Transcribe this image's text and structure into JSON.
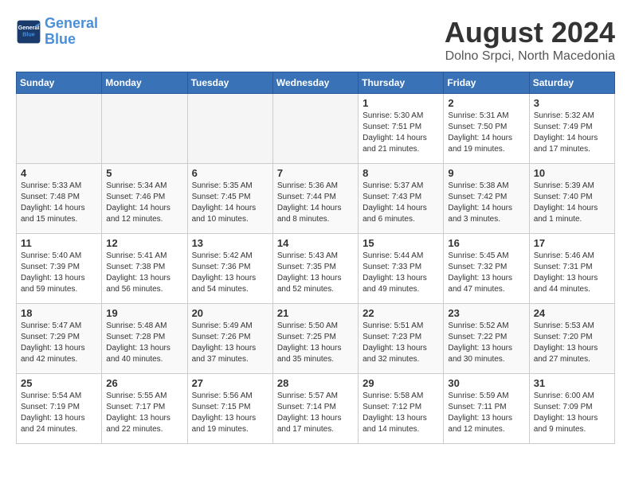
{
  "header": {
    "logo_line1": "General",
    "logo_line2": "Blue",
    "month": "August 2024",
    "location": "Dolno Srpci, North Macedonia"
  },
  "weekdays": [
    "Sunday",
    "Monday",
    "Tuesday",
    "Wednesday",
    "Thursday",
    "Friday",
    "Saturday"
  ],
  "weeks": [
    [
      {
        "day": "",
        "info": ""
      },
      {
        "day": "",
        "info": ""
      },
      {
        "day": "",
        "info": ""
      },
      {
        "day": "",
        "info": ""
      },
      {
        "day": "1",
        "info": "Sunrise: 5:30 AM\nSunset: 7:51 PM\nDaylight: 14 hours\nand 21 minutes."
      },
      {
        "day": "2",
        "info": "Sunrise: 5:31 AM\nSunset: 7:50 PM\nDaylight: 14 hours\nand 19 minutes."
      },
      {
        "day": "3",
        "info": "Sunrise: 5:32 AM\nSunset: 7:49 PM\nDaylight: 14 hours\nand 17 minutes."
      }
    ],
    [
      {
        "day": "4",
        "info": "Sunrise: 5:33 AM\nSunset: 7:48 PM\nDaylight: 14 hours\nand 15 minutes."
      },
      {
        "day": "5",
        "info": "Sunrise: 5:34 AM\nSunset: 7:46 PM\nDaylight: 14 hours\nand 12 minutes."
      },
      {
        "day": "6",
        "info": "Sunrise: 5:35 AM\nSunset: 7:45 PM\nDaylight: 14 hours\nand 10 minutes."
      },
      {
        "day": "7",
        "info": "Sunrise: 5:36 AM\nSunset: 7:44 PM\nDaylight: 14 hours\nand 8 minutes."
      },
      {
        "day": "8",
        "info": "Sunrise: 5:37 AM\nSunset: 7:43 PM\nDaylight: 14 hours\nand 6 minutes."
      },
      {
        "day": "9",
        "info": "Sunrise: 5:38 AM\nSunset: 7:42 PM\nDaylight: 14 hours\nand 3 minutes."
      },
      {
        "day": "10",
        "info": "Sunrise: 5:39 AM\nSunset: 7:40 PM\nDaylight: 14 hours\nand 1 minute."
      }
    ],
    [
      {
        "day": "11",
        "info": "Sunrise: 5:40 AM\nSunset: 7:39 PM\nDaylight: 13 hours\nand 59 minutes."
      },
      {
        "day": "12",
        "info": "Sunrise: 5:41 AM\nSunset: 7:38 PM\nDaylight: 13 hours\nand 56 minutes."
      },
      {
        "day": "13",
        "info": "Sunrise: 5:42 AM\nSunset: 7:36 PM\nDaylight: 13 hours\nand 54 minutes."
      },
      {
        "day": "14",
        "info": "Sunrise: 5:43 AM\nSunset: 7:35 PM\nDaylight: 13 hours\nand 52 minutes."
      },
      {
        "day": "15",
        "info": "Sunrise: 5:44 AM\nSunset: 7:33 PM\nDaylight: 13 hours\nand 49 minutes."
      },
      {
        "day": "16",
        "info": "Sunrise: 5:45 AM\nSunset: 7:32 PM\nDaylight: 13 hours\nand 47 minutes."
      },
      {
        "day": "17",
        "info": "Sunrise: 5:46 AM\nSunset: 7:31 PM\nDaylight: 13 hours\nand 44 minutes."
      }
    ],
    [
      {
        "day": "18",
        "info": "Sunrise: 5:47 AM\nSunset: 7:29 PM\nDaylight: 13 hours\nand 42 minutes."
      },
      {
        "day": "19",
        "info": "Sunrise: 5:48 AM\nSunset: 7:28 PM\nDaylight: 13 hours\nand 40 minutes."
      },
      {
        "day": "20",
        "info": "Sunrise: 5:49 AM\nSunset: 7:26 PM\nDaylight: 13 hours\nand 37 minutes."
      },
      {
        "day": "21",
        "info": "Sunrise: 5:50 AM\nSunset: 7:25 PM\nDaylight: 13 hours\nand 35 minutes."
      },
      {
        "day": "22",
        "info": "Sunrise: 5:51 AM\nSunset: 7:23 PM\nDaylight: 13 hours\nand 32 minutes."
      },
      {
        "day": "23",
        "info": "Sunrise: 5:52 AM\nSunset: 7:22 PM\nDaylight: 13 hours\nand 30 minutes."
      },
      {
        "day": "24",
        "info": "Sunrise: 5:53 AM\nSunset: 7:20 PM\nDaylight: 13 hours\nand 27 minutes."
      }
    ],
    [
      {
        "day": "25",
        "info": "Sunrise: 5:54 AM\nSunset: 7:19 PM\nDaylight: 13 hours\nand 24 minutes."
      },
      {
        "day": "26",
        "info": "Sunrise: 5:55 AM\nSunset: 7:17 PM\nDaylight: 13 hours\nand 22 minutes."
      },
      {
        "day": "27",
        "info": "Sunrise: 5:56 AM\nSunset: 7:15 PM\nDaylight: 13 hours\nand 19 minutes."
      },
      {
        "day": "28",
        "info": "Sunrise: 5:57 AM\nSunset: 7:14 PM\nDaylight: 13 hours\nand 17 minutes."
      },
      {
        "day": "29",
        "info": "Sunrise: 5:58 AM\nSunset: 7:12 PM\nDaylight: 13 hours\nand 14 minutes."
      },
      {
        "day": "30",
        "info": "Sunrise: 5:59 AM\nSunset: 7:11 PM\nDaylight: 13 hours\nand 12 minutes."
      },
      {
        "day": "31",
        "info": "Sunrise: 6:00 AM\nSunset: 7:09 PM\nDaylight: 13 hours\nand 9 minutes."
      }
    ]
  ]
}
